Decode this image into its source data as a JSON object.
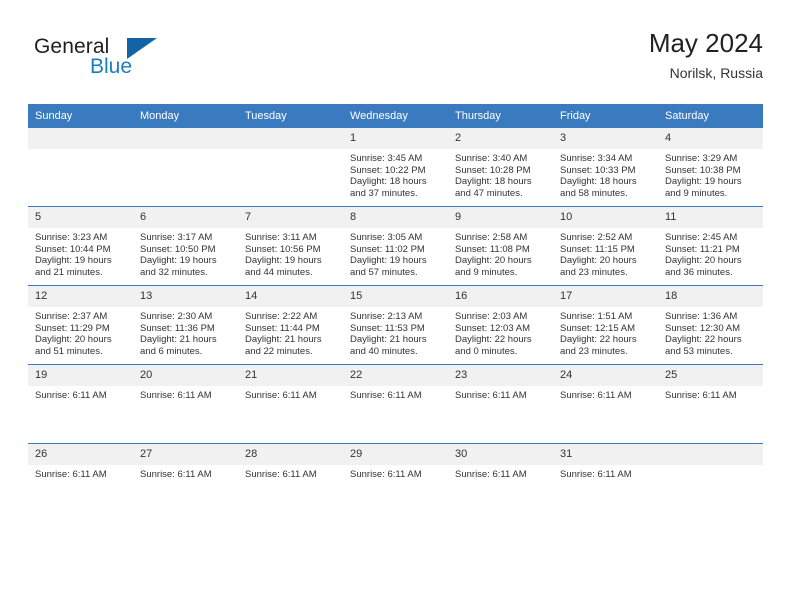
{
  "brand": {
    "name_part1": "General",
    "name_part2": "Blue",
    "mark": "triangle-logo-mark",
    "accent_color": "#1464a5"
  },
  "header": {
    "title": "May 2024",
    "location": "Norilsk, Russia"
  },
  "theme": {
    "header_blue": "#3a7bc0",
    "daynum_band": "#f1f1f1",
    "text": "#333333"
  },
  "weekdays": [
    "Sunday",
    "Monday",
    "Tuesday",
    "Wednesday",
    "Thursday",
    "Friday",
    "Saturday"
  ],
  "weeks": [
    [
      {
        "day": "",
        "lines": []
      },
      {
        "day": "",
        "lines": []
      },
      {
        "day": "",
        "lines": []
      },
      {
        "day": "1",
        "lines": [
          "Sunrise: 3:45 AM",
          "Sunset: 10:22 PM",
          "Daylight: 18 hours",
          "and 37 minutes."
        ]
      },
      {
        "day": "2",
        "lines": [
          "Sunrise: 3:40 AM",
          "Sunset: 10:28 PM",
          "Daylight: 18 hours",
          "and 47 minutes."
        ]
      },
      {
        "day": "3",
        "lines": [
          "Sunrise: 3:34 AM",
          "Sunset: 10:33 PM",
          "Daylight: 18 hours",
          "and 58 minutes."
        ]
      },
      {
        "day": "4",
        "lines": [
          "Sunrise: 3:29 AM",
          "Sunset: 10:38 PM",
          "Daylight: 19 hours",
          "and 9 minutes."
        ]
      }
    ],
    [
      {
        "day": "5",
        "lines": [
          "Sunrise: 3:23 AM",
          "Sunset: 10:44 PM",
          "Daylight: 19 hours",
          "and 21 minutes."
        ]
      },
      {
        "day": "6",
        "lines": [
          "Sunrise: 3:17 AM",
          "Sunset: 10:50 PM",
          "Daylight: 19 hours",
          "and 32 minutes."
        ]
      },
      {
        "day": "7",
        "lines": [
          "Sunrise: 3:11 AM",
          "Sunset: 10:56 PM",
          "Daylight: 19 hours",
          "and 44 minutes."
        ]
      },
      {
        "day": "8",
        "lines": [
          "Sunrise: 3:05 AM",
          "Sunset: 11:02 PM",
          "Daylight: 19 hours",
          "and 57 minutes."
        ]
      },
      {
        "day": "9",
        "lines": [
          "Sunrise: 2:58 AM",
          "Sunset: 11:08 PM",
          "Daylight: 20 hours",
          "and 9 minutes."
        ]
      },
      {
        "day": "10",
        "lines": [
          "Sunrise: 2:52 AM",
          "Sunset: 11:15 PM",
          "Daylight: 20 hours",
          "and 23 minutes."
        ]
      },
      {
        "day": "11",
        "lines": [
          "Sunrise: 2:45 AM",
          "Sunset: 11:21 PM",
          "Daylight: 20 hours",
          "and 36 minutes."
        ]
      }
    ],
    [
      {
        "day": "12",
        "lines": [
          "Sunrise: 2:37 AM",
          "Sunset: 11:29 PM",
          "Daylight: 20 hours",
          "and 51 minutes."
        ]
      },
      {
        "day": "13",
        "lines": [
          "Sunrise: 2:30 AM",
          "Sunset: 11:36 PM",
          "Daylight: 21 hours",
          "and 6 minutes."
        ]
      },
      {
        "day": "14",
        "lines": [
          "Sunrise: 2:22 AM",
          "Sunset: 11:44 PM",
          "Daylight: 21 hours",
          "and 22 minutes."
        ]
      },
      {
        "day": "15",
        "lines": [
          "Sunrise: 2:13 AM",
          "Sunset: 11:53 PM",
          "Daylight: 21 hours",
          "and 40 minutes."
        ]
      },
      {
        "day": "16",
        "lines": [
          "Sunrise: 2:03 AM",
          "Sunset: 12:03 AM",
          "Daylight: 22 hours",
          "and 0 minutes."
        ]
      },
      {
        "day": "17",
        "lines": [
          "Sunrise: 1:51 AM",
          "Sunset: 12:15 AM",
          "Daylight: 22 hours",
          "and 23 minutes."
        ]
      },
      {
        "day": "18",
        "lines": [
          "Sunrise: 1:36 AM",
          "Sunset: 12:30 AM",
          "Daylight: 22 hours",
          "and 53 minutes."
        ]
      }
    ],
    [
      {
        "day": "19",
        "lines": [
          "Sunrise: 6:11 AM"
        ]
      },
      {
        "day": "20",
        "lines": [
          "Sunrise: 6:11 AM"
        ]
      },
      {
        "day": "21",
        "lines": [
          "Sunrise: 6:11 AM"
        ]
      },
      {
        "day": "22",
        "lines": [
          "Sunrise: 6:11 AM"
        ]
      },
      {
        "day": "23",
        "lines": [
          "Sunrise: 6:11 AM"
        ]
      },
      {
        "day": "24",
        "lines": [
          "Sunrise: 6:11 AM"
        ]
      },
      {
        "day": "25",
        "lines": [
          "Sunrise: 6:11 AM"
        ]
      }
    ],
    [
      {
        "day": "26",
        "lines": [
          "Sunrise: 6:11 AM"
        ]
      },
      {
        "day": "27",
        "lines": [
          "Sunrise: 6:11 AM"
        ]
      },
      {
        "day": "28",
        "lines": [
          "Sunrise: 6:11 AM"
        ]
      },
      {
        "day": "29",
        "lines": [
          "Sunrise: 6:11 AM"
        ]
      },
      {
        "day": "30",
        "lines": [
          "Sunrise: 6:11 AM"
        ]
      },
      {
        "day": "31",
        "lines": [
          "Sunrise: 6:11 AM"
        ]
      },
      {
        "day": "",
        "lines": []
      }
    ]
  ]
}
